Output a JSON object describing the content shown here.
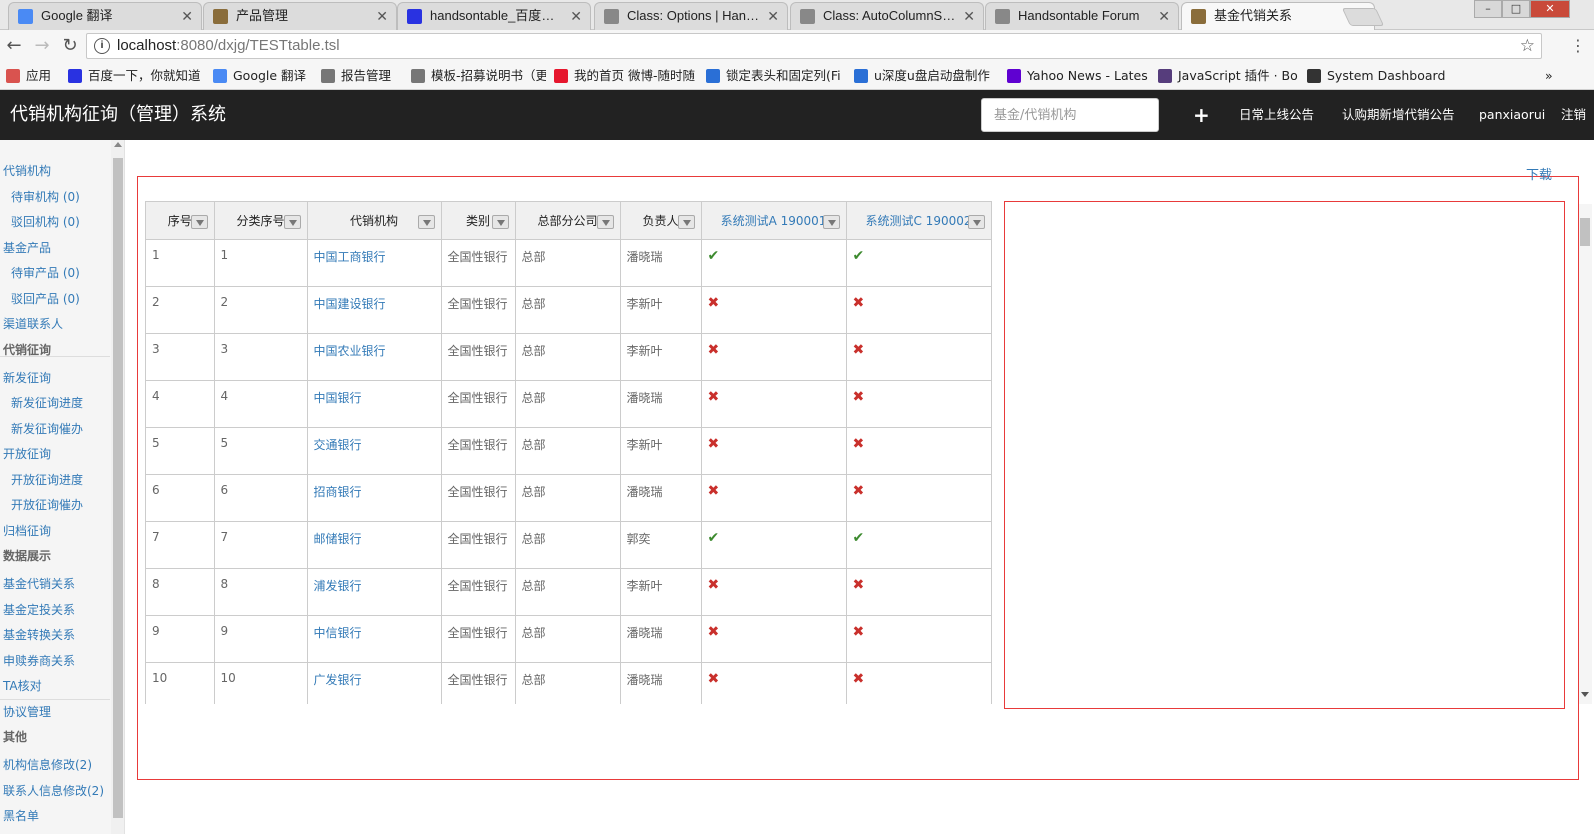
{
  "browser": {
    "tabs": [
      {
        "title": "Google 翻译",
        "icon": "google-translate-icon",
        "color": "#4a8af4"
      },
      {
        "title": "产品管理",
        "icon": "page-icon",
        "color": "#8a6d3b"
      },
      {
        "title": "handsontable_百度搜索",
        "icon": "baidu-icon",
        "color": "#2932e1"
      },
      {
        "title": "Class: Options | Handsontable",
        "icon": "handsontable-icon",
        "color": "#888888"
      },
      {
        "title": "Class: AutoColumnSize",
        "icon": "handsontable-icon",
        "color": "#888888"
      },
      {
        "title": "Handsontable Forum",
        "icon": "handsontable-icon",
        "color": "#888888"
      },
      {
        "title": "基金代销关系",
        "icon": "page-icon",
        "color": "#8a6d3b"
      }
    ],
    "url_host": "localhost",
    "url_rest": ":8080/dxjg/TESTtable.tsl",
    "bookmarks": [
      {
        "label": "应用",
        "icon": "apps-icon",
        "color": "#d9534f"
      },
      {
        "label": "百度一下，你就知道",
        "icon": "baidu-icon",
        "color": "#2932e1"
      },
      {
        "label": "Google 翻译",
        "icon": "google-translate-icon",
        "color": "#4a8af4"
      },
      {
        "label": "报告管理",
        "icon": "page-icon",
        "color": "#777777"
      },
      {
        "label": "模板-招募说明书（更",
        "icon": "page-icon",
        "color": "#777777"
      },
      {
        "label": "我的首页 微博-随时随",
        "icon": "weibo-icon",
        "color": "#e6162d"
      },
      {
        "label": "锁定表头和固定列(Fi",
        "icon": "link-icon",
        "color": "#2a6fd6"
      },
      {
        "label": "u深度u盘启动盘制作",
        "icon": "udeep-icon",
        "color": "#2a6fd6"
      },
      {
        "label": "Yahoo News - Lates",
        "icon": "yahoo-icon",
        "color": "#5f01d1"
      },
      {
        "label": "JavaScript 插件 · Bo",
        "icon": "bootstrap-icon",
        "color": "#563d7c"
      },
      {
        "label": "System Dashboard",
        "icon": "dashboard-icon",
        "color": "#333333"
      }
    ]
  },
  "app": {
    "title": "代销机构征询（管理）系统",
    "search_placeholder": "基金/代销机构",
    "plus": "+",
    "nav": [
      "日常上线公告",
      "认购期新增代销公告",
      "panxiaorui",
      "注销"
    ]
  },
  "sidebar": {
    "items": [
      {
        "label": "代销机构",
        "kind": "link"
      },
      {
        "label": "待审机构 (0)",
        "kind": "sub"
      },
      {
        "label": "驳回机构 (0)",
        "kind": "sub"
      },
      {
        "label": "基金产品",
        "kind": "link"
      },
      {
        "label": "待审产品 (0)",
        "kind": "sub"
      },
      {
        "label": "驳回产品 (0)",
        "kind": "sub"
      },
      {
        "label": "渠道联系人",
        "kind": "link"
      },
      {
        "label": "代销征询",
        "kind": "head"
      },
      {
        "label": "新发征询",
        "kind": "link"
      },
      {
        "label": "新发征询进度",
        "kind": "sub"
      },
      {
        "label": "新发征询催办",
        "kind": "sub"
      },
      {
        "label": "开放征询",
        "kind": "link"
      },
      {
        "label": "开放征询进度",
        "kind": "sub"
      },
      {
        "label": "开放征询催办",
        "kind": "sub"
      },
      {
        "label": "归档征询",
        "kind": "link"
      },
      {
        "label": "数据展示",
        "kind": "head"
      },
      {
        "label": "基金代销关系",
        "kind": "link"
      },
      {
        "label": "基金定投关系",
        "kind": "link"
      },
      {
        "label": "基金转换关系",
        "kind": "link"
      },
      {
        "label": "申赎券商关系",
        "kind": "link"
      },
      {
        "label": "TA核对",
        "kind": "link"
      },
      {
        "label": "协议管理",
        "kind": "link"
      },
      {
        "label": "其他",
        "kind": "head"
      },
      {
        "label": "机构信息修改(2)",
        "kind": "link"
      },
      {
        "label": "联系人信息修改(2)",
        "kind": "link"
      },
      {
        "label": "黑名单",
        "kind": "link"
      }
    ]
  },
  "main": {
    "download": "下载",
    "columns": [
      "序号",
      "分类序号",
      "代销机构",
      "类别",
      "总部分公司",
      "负责人",
      "系统测试A 190001",
      "系统测试C 190002"
    ],
    "rows": [
      [
        "1",
        "1",
        "中国工商银行",
        "全国性银行",
        "总部",
        "潘晓瑞",
        "yes",
        "yes"
      ],
      [
        "2",
        "2",
        "中国建设银行",
        "全国性银行",
        "总部",
        "李新叶",
        "no",
        "no"
      ],
      [
        "3",
        "3",
        "中国农业银行",
        "全国性银行",
        "总部",
        "李新叶",
        "no",
        "no"
      ],
      [
        "4",
        "4",
        "中国银行",
        "全国性银行",
        "总部",
        "潘晓瑞",
        "no",
        "no"
      ],
      [
        "5",
        "5",
        "交通银行",
        "全国性银行",
        "总部",
        "李新叶",
        "no",
        "no"
      ],
      [
        "6",
        "6",
        "招商银行",
        "全国性银行",
        "总部",
        "潘晓瑞",
        "no",
        "no"
      ],
      [
        "7",
        "7",
        "邮储银行",
        "全国性银行",
        "总部",
        "郭奕",
        "yes",
        "yes"
      ],
      [
        "8",
        "8",
        "浦发银行",
        "全国性银行",
        "总部",
        "李新叶",
        "no",
        "no"
      ],
      [
        "9",
        "9",
        "中信银行",
        "全国性银行",
        "总部",
        "潘晓瑞",
        "no",
        "no"
      ],
      [
        "10",
        "10",
        "广发银行",
        "全国性银行",
        "总部",
        "潘晓瑞",
        "no",
        "no"
      ]
    ]
  }
}
